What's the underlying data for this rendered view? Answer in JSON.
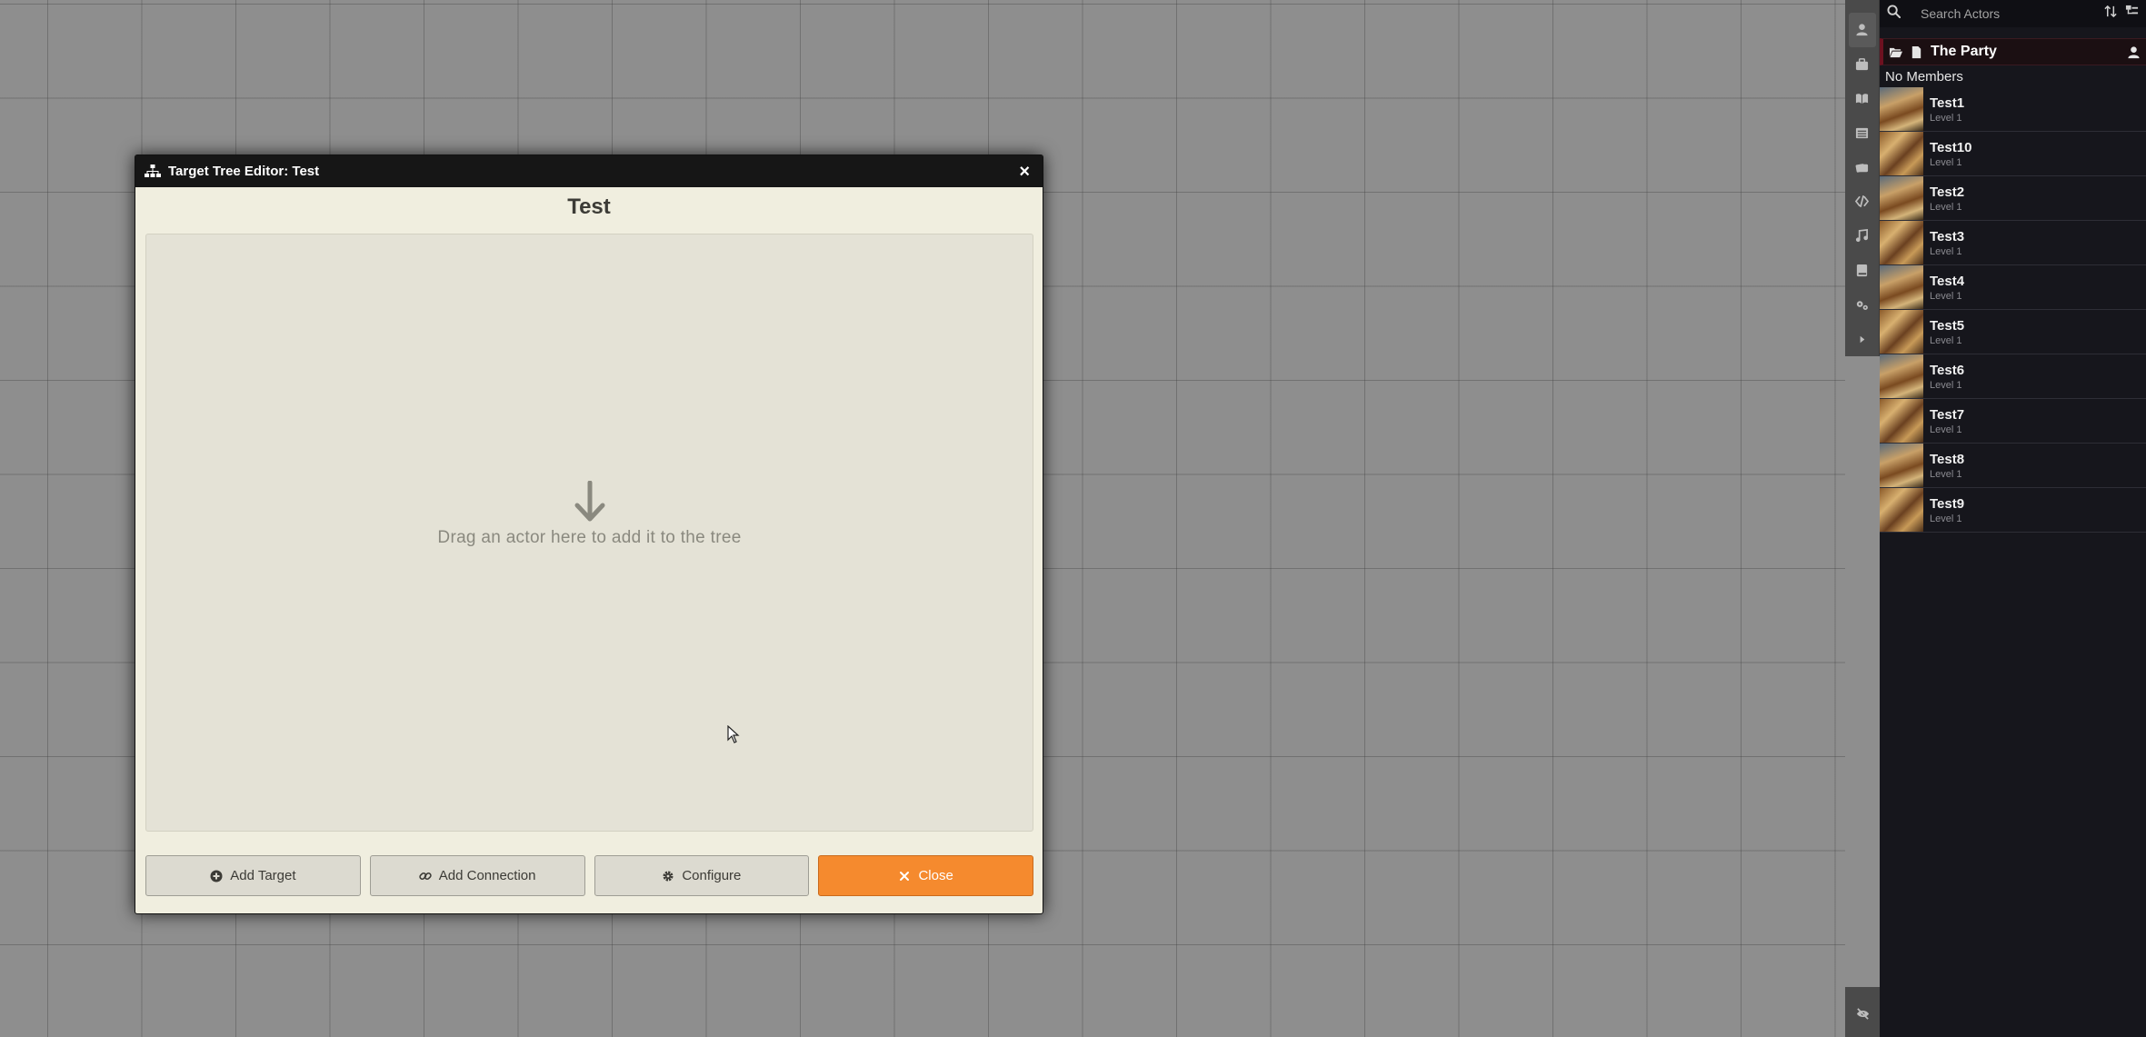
{
  "dialog": {
    "header_title": "Target Tree Editor: Test",
    "close_glyph": "×",
    "tree_title": "Test",
    "drop_hint": "Drag an actor here to add it to the tree",
    "buttons": {
      "add_target": "Add Target",
      "add_connection": "Add Connection",
      "configure": "Configure",
      "close": "Close"
    },
    "colors": {
      "primary_button": "#f58a2e",
      "header_bg": "#161616",
      "body_bg": "#f0eedf"
    }
  },
  "sidebar": {
    "search_placeholder": "Search Actors",
    "tabs": [
      "actors-icon",
      "items-icon",
      "journal-icon",
      "tables-icon",
      "cards-icon",
      "macros-icon",
      "playlists-icon",
      "compendium-icon",
      "settings-icon",
      "collapse-icon"
    ],
    "folder": {
      "name": "The Party",
      "empty_text": "No Members",
      "accent": "#6d1120"
    },
    "actors": [
      {
        "name": "Test1",
        "level": "Level 1"
      },
      {
        "name": "Test10",
        "level": "Level 1"
      },
      {
        "name": "Test2",
        "level": "Level 1"
      },
      {
        "name": "Test3",
        "level": "Level 1"
      },
      {
        "name": "Test4",
        "level": "Level 1"
      },
      {
        "name": "Test5",
        "level": "Level 1"
      },
      {
        "name": "Test6",
        "level": "Level 1"
      },
      {
        "name": "Test7",
        "level": "Level 1"
      },
      {
        "name": "Test8",
        "level": "Level 1"
      },
      {
        "name": "Test9",
        "level": "Level 1"
      }
    ]
  }
}
